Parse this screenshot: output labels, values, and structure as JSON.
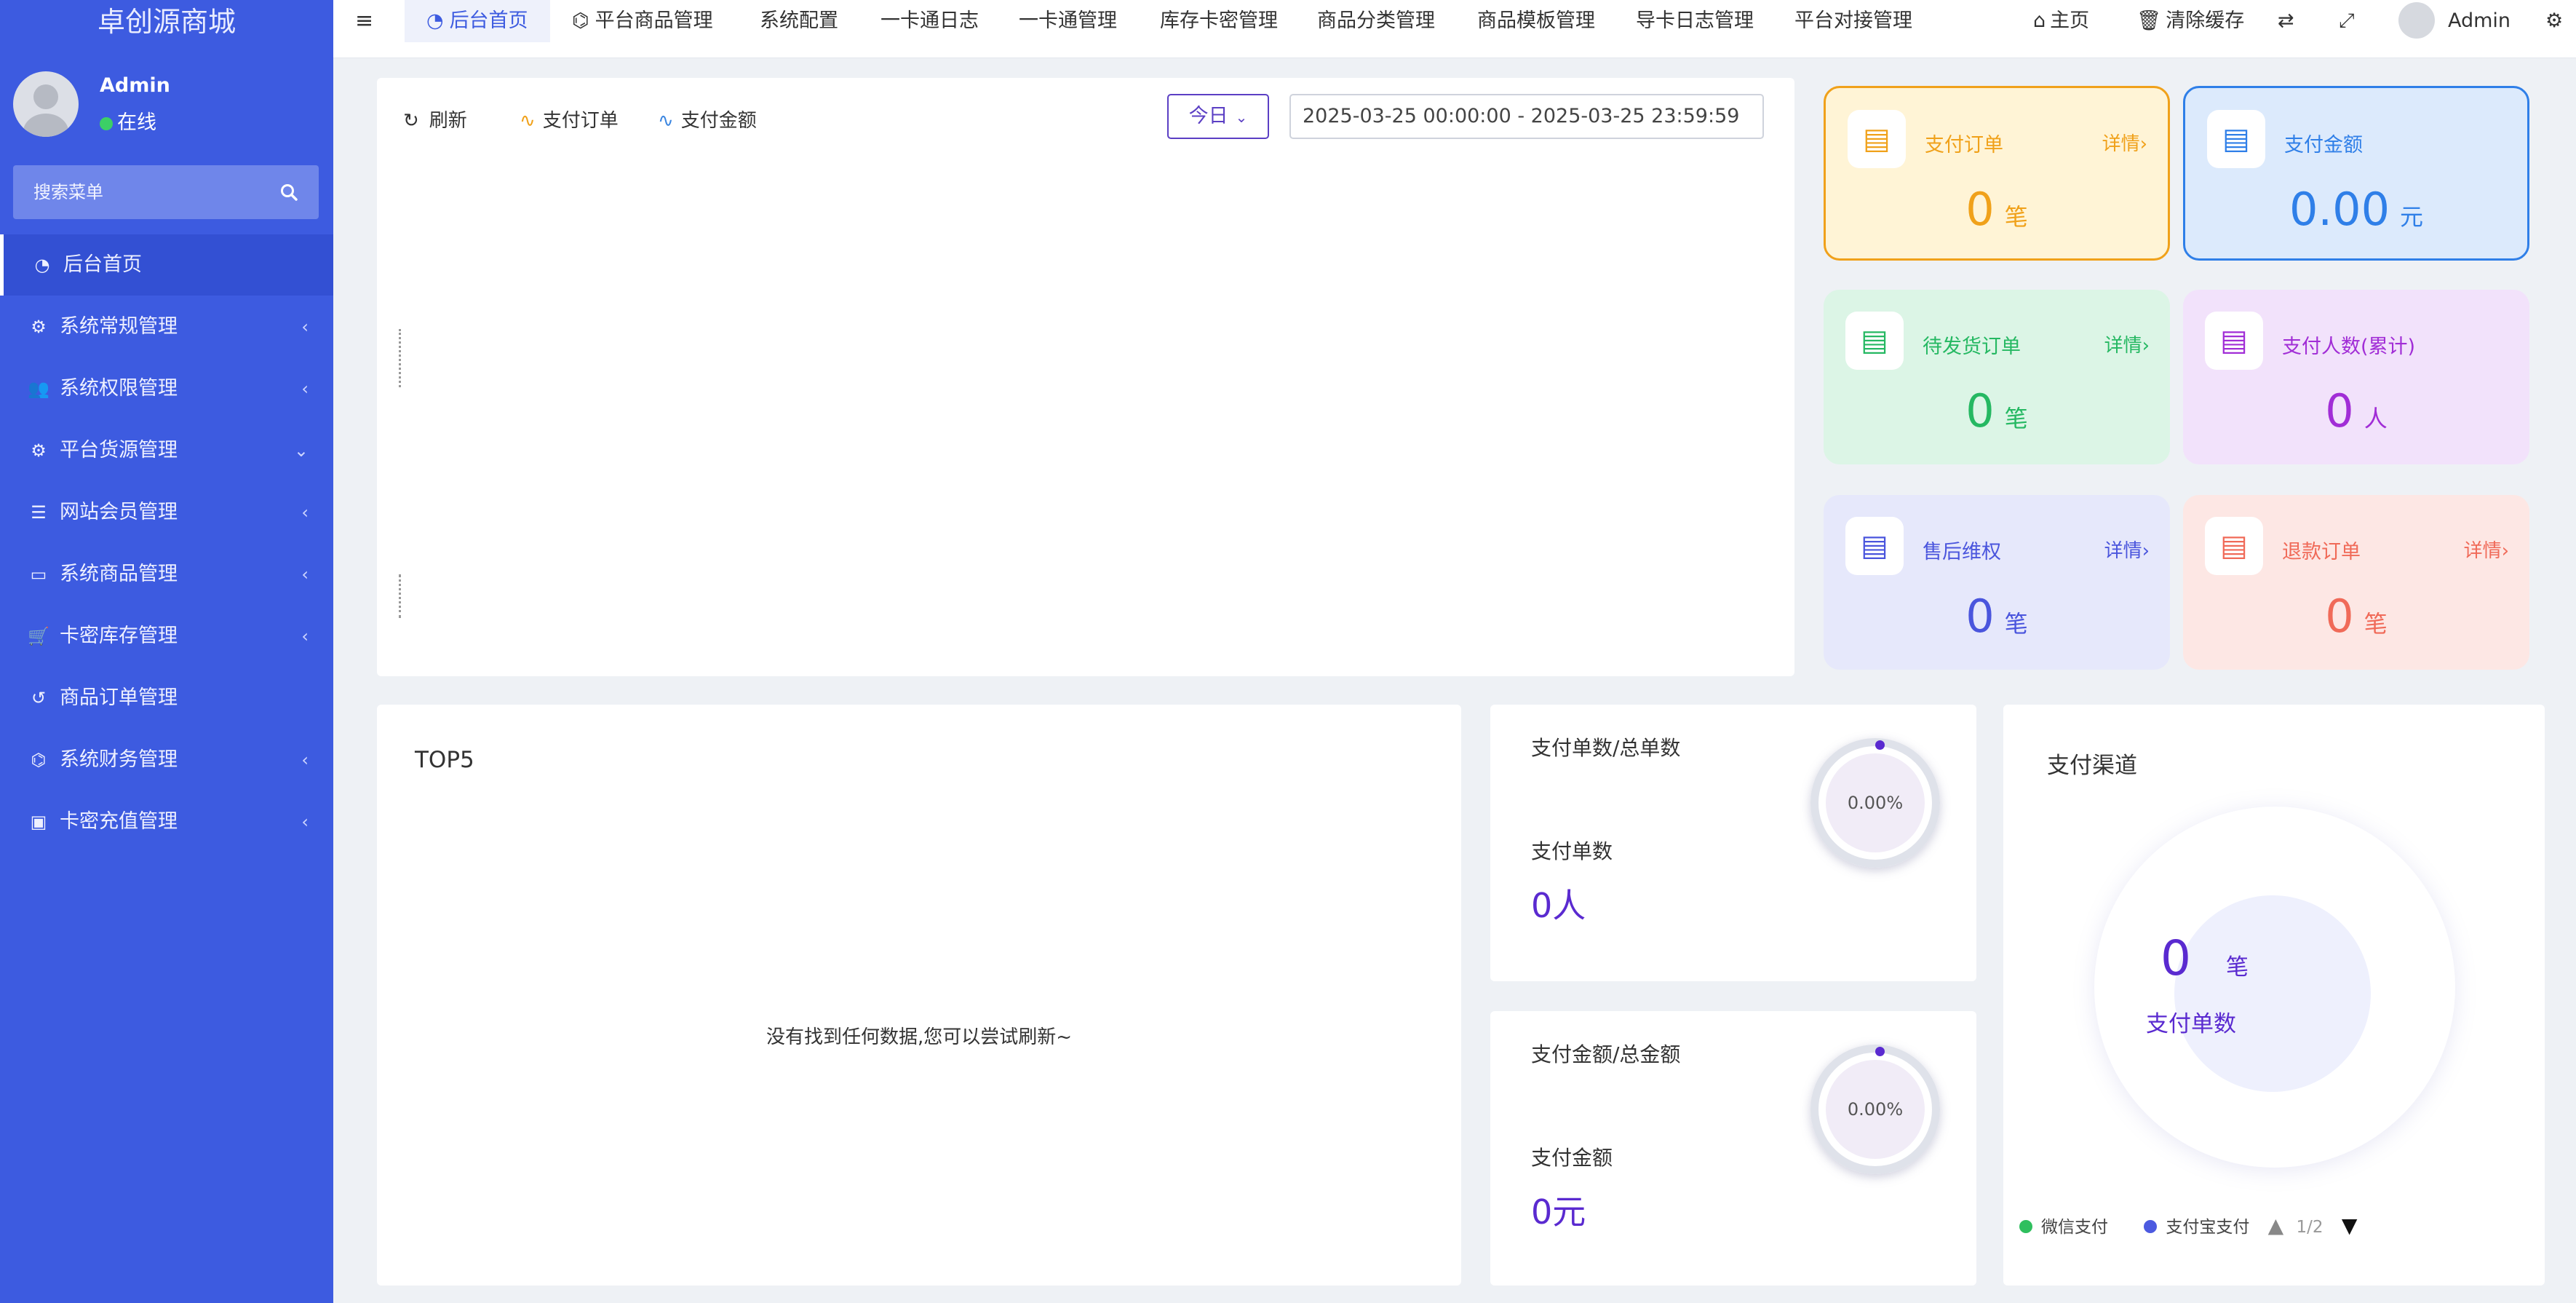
{
  "sidebar": {
    "brand": "卓创源商城",
    "user": {
      "name": "Admin",
      "status": "在线"
    },
    "search_placeholder": "搜索菜单",
    "items": [
      {
        "label": "后台首页",
        "icon": "dashboard-icon",
        "arrow": ""
      },
      {
        "label": "系统常规管理",
        "icon": "gears-icon",
        "arrow": "‹"
      },
      {
        "label": "系统权限管理",
        "icon": "users-icon",
        "arrow": "‹"
      },
      {
        "label": "平台货源管理",
        "icon": "gears-icon",
        "arrow": "⌄"
      },
      {
        "label": "网站会员管理",
        "icon": "list-icon",
        "arrow": "‹"
      },
      {
        "label": "系统商品管理",
        "icon": "jcb-icon",
        "arrow": "‹"
      },
      {
        "label": "卡密库存管理",
        "icon": "cart-icon",
        "arrow": "‹"
      },
      {
        "label": "商品订单管理",
        "icon": "history-icon",
        "arrow": ""
      },
      {
        "label": "系统财务管理",
        "icon": "binoculars-icon",
        "arrow": "‹"
      },
      {
        "label": "卡密充值管理",
        "icon": "money-icon",
        "arrow": "‹"
      }
    ]
  },
  "topbar": {
    "tabs": [
      "后台首页",
      "平台商品管理",
      "系统配置",
      "一卡通日志",
      "一卡通管理",
      "库存卡密管理",
      "商品分类管理",
      "商品模板管理",
      "导卡日志管理",
      "平台对接管理"
    ],
    "home": "主页",
    "clear_cache": "清除缓存",
    "admin": "Admin"
  },
  "chart_panel": {
    "refresh": "刷新",
    "legend_orders": "支付订单",
    "legend_amount": "支付金额",
    "range_select": "今日",
    "date_range": "2025-03-25 00:00:00 - 2025-03-25 23:59:59"
  },
  "cards": [
    {
      "title": "支付订单",
      "detail": "详情›",
      "value": "0",
      "unit": "笔",
      "color": "#f0a11a",
      "bg": "#fff4d6",
      "icon": "order-list-icon"
    },
    {
      "title": "支付金额",
      "detail": "",
      "value": "0.00",
      "unit": "元",
      "color": "#2f7fe8",
      "bg": "#dceafc",
      "icon": "money-bag-icon"
    },
    {
      "title": "待发货订单",
      "detail": "详情›",
      "value": "0",
      "unit": "笔",
      "color": "#25b862",
      "bg": "#dcf5e6",
      "icon": "box-icon"
    },
    {
      "title": "支付人数(累计)",
      "detail": "",
      "value": "0",
      "unit": "人",
      "color": "#a12dd6",
      "bg": "#f2e2fb",
      "icon": "clipboard-icon"
    },
    {
      "title": "售后维权",
      "detail": "详情›",
      "value": "0",
      "unit": "笔",
      "color": "#4a55dd",
      "bg": "#e6e8fb",
      "icon": "after-sale-icon"
    },
    {
      "title": "退款订单",
      "detail": "详情›",
      "value": "0",
      "unit": "笔",
      "color": "#f06a58",
      "bg": "#fde7e4",
      "icon": "layers-icon"
    }
  ],
  "top5": {
    "title": "TOP5",
    "empty": "没有找到任何数据,您可以尝试刷新~"
  },
  "ratio_orders": {
    "title": "支付单数/总单数",
    "percent": "0.00%",
    "label": "支付单数",
    "value": "0人"
  },
  "ratio_amount": {
    "title": "支付金额/总金额",
    "percent": "0.00%",
    "label": "支付金额",
    "value": "0元"
  },
  "channels": {
    "title": "支付渠道",
    "value": "0",
    "unit": "笔",
    "label": "支付单数",
    "legend": [
      {
        "name": "微信支付",
        "color": "#2fbf5e"
      },
      {
        "name": "支付宝支付",
        "color": "#4c5ae0"
      }
    ],
    "page": "1/2"
  }
}
